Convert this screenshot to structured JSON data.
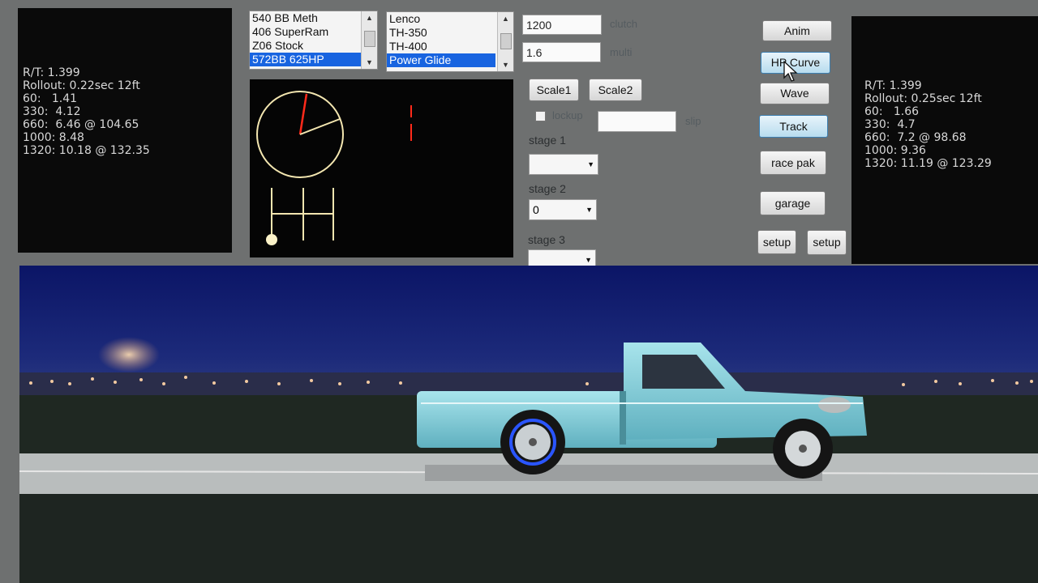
{
  "left_stats": {
    "lines": [
      "R/T: 1.399",
      "Rollout: 0.22sec 12ft",
      "60:   1.41",
      "330:  4.12",
      "660:  6.46 @ 104.65",
      "1000: 8.48",
      "1320: 10.18 @ 132.35"
    ]
  },
  "right_stats": {
    "lines": [
      "R/T: 1.399",
      "Rollout: 0.25sec 12ft",
      "60:   1.66",
      "330:  4.7",
      "660:  7.2 @ 98.68",
      "1000: 9.36",
      "1320: 11.19 @ 123.29"
    ]
  },
  "engine_list": {
    "items": [
      "540 BB Meth",
      "406 SuperRam",
      "Z06 Stock",
      "572BB 625HP"
    ],
    "selected": "572BB 625HP"
  },
  "trans_list": {
    "items": [
      "Lenco",
      "TH-350",
      "TH-400",
      "Power Glide"
    ],
    "selected": "Power Glide"
  },
  "clutch": {
    "value": "1200",
    "label": "clutch"
  },
  "multi": {
    "value": "1.6",
    "label": "multi"
  },
  "scale1_label": "Scale1",
  "scale2_label": "Scale2",
  "lockup": {
    "label": "lockup",
    "checked": false
  },
  "slip": {
    "value": "",
    "label": "slip"
  },
  "stages": [
    {
      "label": "stage 1",
      "value": ""
    },
    {
      "label": "stage 2",
      "value": "0"
    },
    {
      "label": "stage 3",
      "value": ""
    }
  ],
  "buttons": {
    "anim": "Anim",
    "hp_curve": "HP Curve",
    "wave": "Wave",
    "track": "Track",
    "race_pak": "race pak",
    "garage": "garage",
    "setup1": "setup",
    "setup2": "setup"
  },
  "colors": {
    "sky_top": "#0d1a6e",
    "sky_bottom": "#1c2a7a",
    "truck_body": "#7dc8d4",
    "selection": "#1864e0",
    "gauge_needle": "#ff2a1a",
    "gauge_dial": "#f3e6b0"
  },
  "icons": {
    "cursor": "mouse-pointer-icon"
  }
}
